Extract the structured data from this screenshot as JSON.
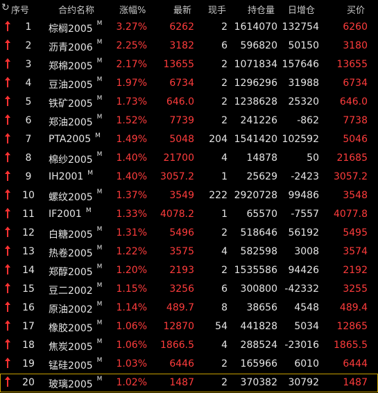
{
  "header": {
    "refresh_icon": "refresh-icon",
    "columns": [
      "序号",
      "合约名称",
      "涨幅%",
      "最新",
      "现手",
      "持仓量",
      "日增仓",
      "买价"
    ]
  },
  "rows": [
    {
      "idx": "1",
      "name": "棕榈2005",
      "tag": "M",
      "chg": "3.27%",
      "last": "6262",
      "hand": "2",
      "oi": "1614070",
      "doi": "132754",
      "bid": "6260"
    },
    {
      "idx": "2",
      "name": "沥青2006",
      "tag": "M",
      "chg": "2.25%",
      "last": "3182",
      "hand": "6",
      "oi": "596820",
      "doi": "50150",
      "bid": "3180"
    },
    {
      "idx": "3",
      "name": "郑棉2005",
      "tag": "M",
      "chg": "2.17%",
      "last": "13655",
      "hand": "2",
      "oi": "1071834",
      "doi": "157646",
      "bid": "13655"
    },
    {
      "idx": "4",
      "name": "豆油2005",
      "tag": "M",
      "chg": "1.97%",
      "last": "6734",
      "hand": "2",
      "oi": "1296296",
      "doi": "31988",
      "bid": "6734"
    },
    {
      "idx": "5",
      "name": "铁矿2005",
      "tag": "M",
      "chg": "1.73%",
      "last": "646.0",
      "hand": "2",
      "oi": "1238628",
      "doi": "25320",
      "bid": "646.0"
    },
    {
      "idx": "6",
      "name": "郑油2005",
      "tag": "M",
      "chg": "1.52%",
      "last": "7739",
      "hand": "2",
      "oi": "241226",
      "doi": "-862",
      "bid": "7738"
    },
    {
      "idx": "7",
      "name": "PTA2005",
      "tag": "M",
      "chg": "1.49%",
      "last": "5048",
      "hand": "204",
      "oi": "1541420",
      "doi": "102592",
      "bid": "5046"
    },
    {
      "idx": "8",
      "name": "棉纱2005",
      "tag": "M",
      "chg": "1.40%",
      "last": "21700",
      "hand": "4",
      "oi": "14878",
      "doi": "50",
      "bid": "21685"
    },
    {
      "idx": "9",
      "name": "IH2001",
      "tag": "M",
      "chg": "1.40%",
      "last": "3057.2",
      "hand": "1",
      "oi": "25629",
      "doi": "-2423",
      "bid": "3057.2"
    },
    {
      "idx": "10",
      "name": "螺纹2005",
      "tag": "M",
      "chg": "1.37%",
      "last": "3549",
      "hand": "222",
      "oi": "2920728",
      "doi": "99486",
      "bid": "3548"
    },
    {
      "idx": "11",
      "name": "IF2001",
      "tag": "M",
      "chg": "1.33%",
      "last": "4078.2",
      "hand": "1",
      "oi": "65570",
      "doi": "-7557",
      "bid": "4077.8"
    },
    {
      "idx": "12",
      "name": "白糖2005",
      "tag": "M",
      "chg": "1.31%",
      "last": "5496",
      "hand": "2",
      "oi": "518646",
      "doi": "56192",
      "bid": "5495"
    },
    {
      "idx": "13",
      "name": "热卷2005",
      "tag": "M",
      "chg": "1.22%",
      "last": "3575",
      "hand": "4",
      "oi": "582598",
      "doi": "3008",
      "bid": "3574"
    },
    {
      "idx": "14",
      "name": "郑醇2005",
      "tag": "M",
      "chg": "1.20%",
      "last": "2193",
      "hand": "2",
      "oi": "1535586",
      "doi": "94426",
      "bid": "2192"
    },
    {
      "idx": "15",
      "name": "豆二2002",
      "tag": "M",
      "chg": "1.15%",
      "last": "3256",
      "hand": "6",
      "oi": "300800",
      "doi": "-42332",
      "bid": "3255"
    },
    {
      "idx": "16",
      "name": "原油2002",
      "tag": "M",
      "chg": "1.14%",
      "last": "489.7",
      "hand": "8",
      "oi": "38656",
      "doi": "4548",
      "bid": "489.4"
    },
    {
      "idx": "17",
      "name": "橡胶2005",
      "tag": "M",
      "chg": "1.06%",
      "last": "12870",
      "hand": "54",
      "oi": "441828",
      "doi": "5034",
      "bid": "12865"
    },
    {
      "idx": "18",
      "name": "焦炭2005",
      "tag": "M",
      "chg": "1.06%",
      "last": "1866.5",
      "hand": "4",
      "oi": "288524",
      "doi": "-23016",
      "bid": "1865.5"
    },
    {
      "idx": "19",
      "name": "锰硅2005",
      "tag": "M",
      "chg": "1.03%",
      "last": "6446",
      "hand": "2",
      "oi": "165966",
      "doi": "6010",
      "bid": "6444"
    },
    {
      "idx": "20",
      "name": "玻璃2005",
      "tag": "M",
      "chg": "1.02%",
      "last": "1487",
      "hand": "2",
      "oi": "370382",
      "doi": "30792",
      "bid": "1487"
    }
  ],
  "colors": {
    "up": "#ff3c3c",
    "text": "#e6e6e6",
    "header": "#c8c8c8",
    "background": "#000000",
    "selected_border": "#c8a000"
  }
}
